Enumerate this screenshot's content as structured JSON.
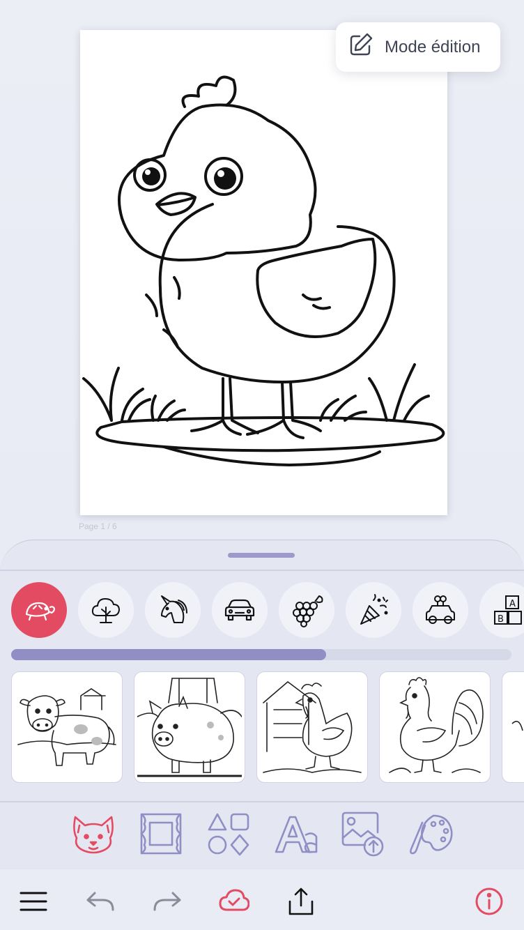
{
  "canvas": {
    "page_indicator": "Page 1 / 6",
    "subject": "chick coloring page"
  },
  "mode_button": {
    "label": "Mode édition",
    "icon": "pencil-edit-icon"
  },
  "sheet": {
    "categories": [
      {
        "icon": "turtle-icon",
        "active": true
      },
      {
        "icon": "tree-icon",
        "active": false
      },
      {
        "icon": "unicorn-icon",
        "active": false
      },
      {
        "icon": "car-icon",
        "active": false
      },
      {
        "icon": "grapes-icon",
        "active": false
      },
      {
        "icon": "party-popper-icon",
        "active": false
      },
      {
        "icon": "toy-car-icon",
        "active": false
      },
      {
        "icon": "abc-blocks-icon",
        "active": false
      }
    ],
    "scroll_progress": 0.63,
    "thumbnails": [
      {
        "subject": "cow"
      },
      {
        "subject": "pig"
      },
      {
        "subject": "hen"
      },
      {
        "subject": "rooster"
      }
    ],
    "tools": [
      {
        "icon": "fox-sticker-icon"
      },
      {
        "icon": "frame-icon"
      },
      {
        "icon": "shapes-icon"
      },
      {
        "icon": "text-icon"
      },
      {
        "icon": "image-upload-icon"
      },
      {
        "icon": "palette-icon"
      }
    ]
  },
  "bottom_bar": [
    {
      "icon": "menu-icon"
    },
    {
      "icon": "undo-icon"
    },
    {
      "icon": "redo-icon"
    },
    {
      "icon": "cloud-save-icon"
    },
    {
      "icon": "share-icon"
    },
    {
      "icon": "info-icon"
    }
  ],
  "colors": {
    "accent": "#e34b62",
    "lavender": "#908ec4",
    "sheet_bg": "#e4e7f2"
  }
}
